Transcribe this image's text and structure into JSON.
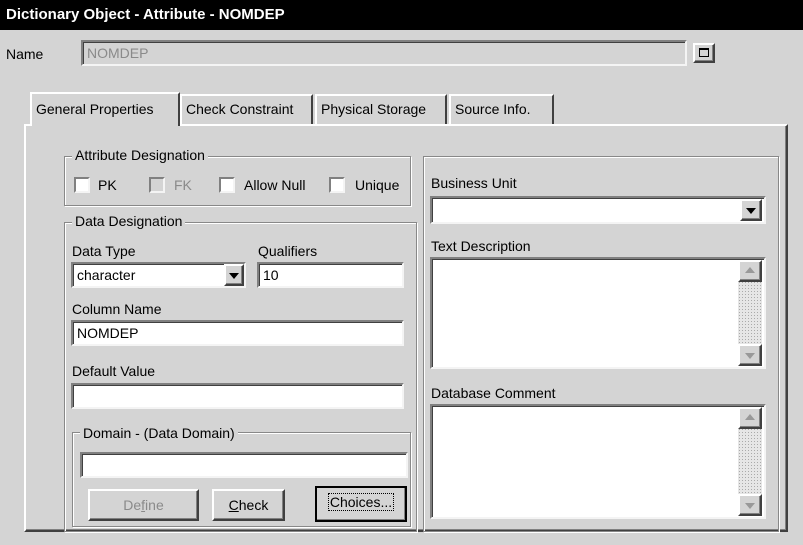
{
  "window": {
    "title": "Dictionary Object - Attribute - NOMDEP"
  },
  "name_row": {
    "label": "Name",
    "value": "NOMDEP"
  },
  "tabs": [
    {
      "label": "General Properties",
      "active": true
    },
    {
      "label": "Check Constraint",
      "active": false
    },
    {
      "label": "Physical Storage",
      "active": false
    },
    {
      "label": "Source Info.",
      "active": false
    }
  ],
  "attribute_designation": {
    "legend": "Attribute Designation",
    "pk": {
      "label": "PK",
      "checked": false
    },
    "fk": {
      "label": "FK",
      "checked": false,
      "disabled": true
    },
    "allow_null": {
      "label": "Allow Null",
      "checked": false
    },
    "unique": {
      "label": "Unique",
      "checked": false
    }
  },
  "data_designation": {
    "legend": "Data Designation",
    "data_type_label": "Data Type",
    "data_type_value": "character",
    "qualifiers_label": "Qualifiers",
    "qualifiers_value": "10",
    "column_name_label": "Column Name",
    "column_name_value": "NOMDEP",
    "default_value_label": "Default Value",
    "default_value_value": ""
  },
  "domain": {
    "legend": "Domain - (Data Domain)",
    "value": "",
    "define_pre": "De",
    "define_mn": "f",
    "define_post": "ine",
    "check_pre": "C",
    "check_post": "heck",
    "choices_label": "Choices..."
  },
  "right_panel": {
    "business_unit_label": "Business Unit",
    "business_unit_value": "",
    "text_description_label": "Text Description",
    "text_description_value": "",
    "database_comment_label": "Database Comment",
    "database_comment_value": ""
  },
  "icons": {
    "name_button": "maximize-square-icon",
    "dropdown": "chevron-down-icon",
    "scroll_up": "scroll-up-arrow-icon",
    "scroll_down": "scroll-down-arrow-icon"
  }
}
